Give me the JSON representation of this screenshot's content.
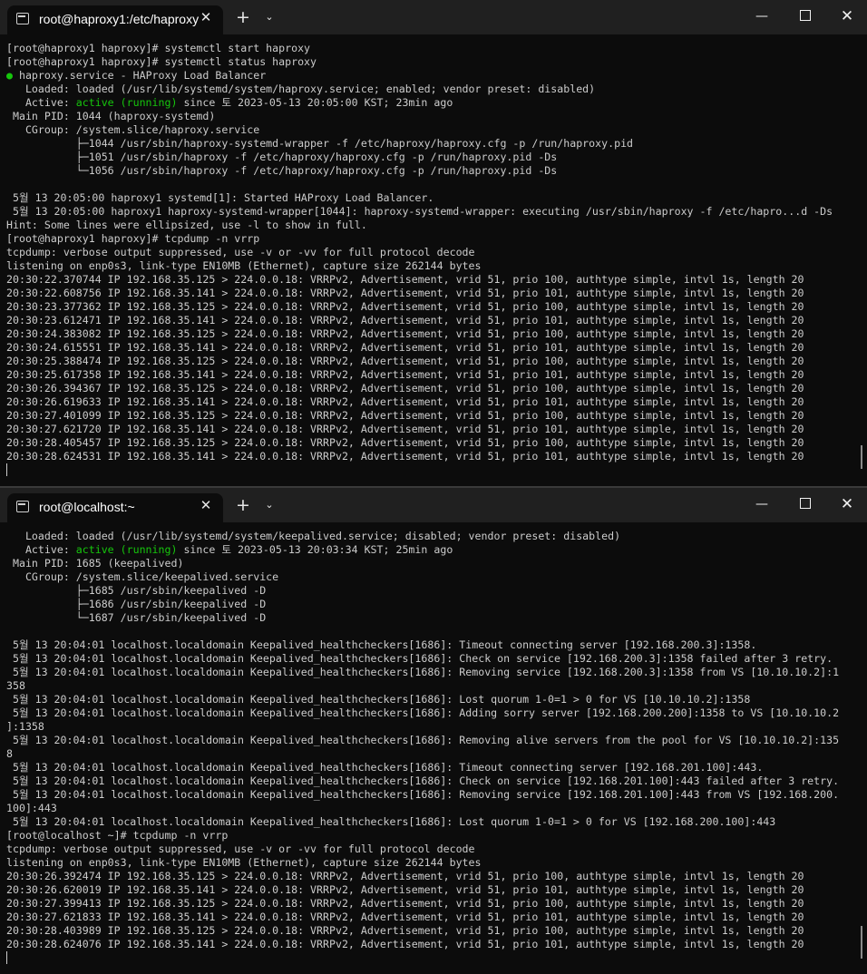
{
  "window1": {
    "tab_title": "root@haproxy1:/etc/haproxy",
    "lines": [
      "[root@haproxy1 haproxy]# systemctl start haproxy",
      "[root@haproxy1 haproxy]# systemctl status haproxy",
      "● haproxy.service - HAProxy Load Balancer",
      "   Loaded: loaded (/usr/lib/systemd/system/haproxy.service; enabled; vendor preset: disabled)",
      "   Active: active (running) since 토 2023-05-13 20:05:00 KST; 23min ago",
      " Main PID: 1044 (haproxy-systemd)",
      "   CGroup: /system.slice/haproxy.service",
      "           ├─1044 /usr/sbin/haproxy-systemd-wrapper -f /etc/haproxy/haproxy.cfg -p /run/haproxy.pid",
      "           ├─1051 /usr/sbin/haproxy -f /etc/haproxy/haproxy.cfg -p /run/haproxy.pid -Ds",
      "           └─1056 /usr/sbin/haproxy -f /etc/haproxy/haproxy.cfg -p /run/haproxy.pid -Ds",
      "",
      " 5월 13 20:05:00 haproxy1 systemd[1]: Started HAProxy Load Balancer.",
      " 5월 13 20:05:00 haproxy1 haproxy-systemd-wrapper[1044]: haproxy-systemd-wrapper: executing /usr/sbin/haproxy -f /etc/hapro...d -Ds",
      "Hint: Some lines were ellipsized, use -l to show in full.",
      "[root@haproxy1 haproxy]# tcpdump -n vrrp",
      "tcpdump: verbose output suppressed, use -v or -vv for full protocol decode",
      "listening on enp0s3, link-type EN10MB (Ethernet), capture size 262144 bytes",
      "20:30:22.370744 IP 192.168.35.125 > 224.0.0.18: VRRPv2, Advertisement, vrid 51, prio 100, authtype simple, intvl 1s, length 20",
      "20:30:22.608756 IP 192.168.35.141 > 224.0.0.18: VRRPv2, Advertisement, vrid 51, prio 101, authtype simple, intvl 1s, length 20",
      "20:30:23.377362 IP 192.168.35.125 > 224.0.0.18: VRRPv2, Advertisement, vrid 51, prio 100, authtype simple, intvl 1s, length 20",
      "20:30:23.612471 IP 192.168.35.141 > 224.0.0.18: VRRPv2, Advertisement, vrid 51, prio 101, authtype simple, intvl 1s, length 20",
      "20:30:24.383082 IP 192.168.35.125 > 224.0.0.18: VRRPv2, Advertisement, vrid 51, prio 100, authtype simple, intvl 1s, length 20",
      "20:30:24.615551 IP 192.168.35.141 > 224.0.0.18: VRRPv2, Advertisement, vrid 51, prio 101, authtype simple, intvl 1s, length 20",
      "20:30:25.388474 IP 192.168.35.125 > 224.0.0.18: VRRPv2, Advertisement, vrid 51, prio 100, authtype simple, intvl 1s, length 20",
      "20:30:25.617358 IP 192.168.35.141 > 224.0.0.18: VRRPv2, Advertisement, vrid 51, prio 101, authtype simple, intvl 1s, length 20",
      "20:30:26.394367 IP 192.168.35.125 > 224.0.0.18: VRRPv2, Advertisement, vrid 51, prio 100, authtype simple, intvl 1s, length 20",
      "20:30:26.619633 IP 192.168.35.141 > 224.0.0.18: VRRPv2, Advertisement, vrid 51, prio 101, authtype simple, intvl 1s, length 20",
      "20:30:27.401099 IP 192.168.35.125 > 224.0.0.18: VRRPv2, Advertisement, vrid 51, prio 100, authtype simple, intvl 1s, length 20",
      "20:30:27.621720 IP 192.168.35.141 > 224.0.0.18: VRRPv2, Advertisement, vrid 51, prio 101, authtype simple, intvl 1s, length 20",
      "20:30:28.405457 IP 192.168.35.125 > 224.0.0.18: VRRPv2, Advertisement, vrid 51, prio 100, authtype simple, intvl 1s, length 20",
      "20:30:28.624531 IP 192.168.35.141 > 224.0.0.18: VRRPv2, Advertisement, vrid 51, prio 101, authtype simple, intvl 1s, length 20"
    ]
  },
  "window2": {
    "tab_title": "root@localhost:~",
    "lines": [
      "   Loaded: loaded (/usr/lib/systemd/system/keepalived.service; disabled; vendor preset: disabled)",
      "   Active: active (running) since 토 2023-05-13 20:03:34 KST; 25min ago",
      " Main PID: 1685 (keepalived)",
      "   CGroup: /system.slice/keepalived.service",
      "           ├─1685 /usr/sbin/keepalived -D",
      "           ├─1686 /usr/sbin/keepalived -D",
      "           └─1687 /usr/sbin/keepalived -D",
      "",
      " 5월 13 20:04:01 localhost.localdomain Keepalived_healthcheckers[1686]: Timeout connecting server [192.168.200.3]:1358.",
      " 5월 13 20:04:01 localhost.localdomain Keepalived_healthcheckers[1686]: Check on service [192.168.200.3]:1358 failed after 3 retry.",
      " 5월 13 20:04:01 localhost.localdomain Keepalived_healthcheckers[1686]: Removing service [192.168.200.3]:1358 from VS [10.10.10.2]:1",
      "358",
      " 5월 13 20:04:01 localhost.localdomain Keepalived_healthcheckers[1686]: Lost quorum 1-0=1 > 0 for VS [10.10.10.2]:1358",
      " 5월 13 20:04:01 localhost.localdomain Keepalived_healthcheckers[1686]: Adding sorry server [192.168.200.200]:1358 to VS [10.10.10.2",
      "]:1358",
      " 5월 13 20:04:01 localhost.localdomain Keepalived_healthcheckers[1686]: Removing alive servers from the pool for VS [10.10.10.2]:135",
      "8",
      " 5월 13 20:04:01 localhost.localdomain Keepalived_healthcheckers[1686]: Timeout connecting server [192.168.201.100]:443.",
      " 5월 13 20:04:01 localhost.localdomain Keepalived_healthcheckers[1686]: Check on service [192.168.201.100]:443 failed after 3 retry.",
      " 5월 13 20:04:01 localhost.localdomain Keepalived_healthcheckers[1686]: Removing service [192.168.201.100]:443 from VS [192.168.200.",
      "100]:443",
      " 5월 13 20:04:01 localhost.localdomain Keepalived_healthcheckers[1686]: Lost quorum 1-0=1 > 0 for VS [192.168.200.100]:443",
      "[root@localhost ~]# tcpdump -n vrrp",
      "tcpdump: verbose output suppressed, use -v or -vv for full protocol decode",
      "listening on enp0s3, link-type EN10MB (Ethernet), capture size 262144 bytes",
      "20:30:26.392474 IP 192.168.35.125 > 224.0.0.18: VRRPv2, Advertisement, vrid 51, prio 100, authtype simple, intvl 1s, length 20",
      "20:30:26.620019 IP 192.168.35.141 > 224.0.0.18: VRRPv2, Advertisement, vrid 51, prio 101, authtype simple, intvl 1s, length 20",
      "20:30:27.399413 IP 192.168.35.125 > 224.0.0.18: VRRPv2, Advertisement, vrid 51, prio 100, authtype simple, intvl 1s, length 20",
      "20:30:27.621833 IP 192.168.35.141 > 224.0.0.18: VRRPv2, Advertisement, vrid 51, prio 101, authtype simple, intvl 1s, length 20",
      "20:30:28.403989 IP 192.168.35.125 > 224.0.0.18: VRRPv2, Advertisement, vrid 51, prio 100, authtype simple, intvl 1s, length 20",
      "20:30:28.624076 IP 192.168.35.141 > 224.0.0.18: VRRPv2, Advertisement, vrid 51, prio 101, authtype simple, intvl 1s, length 20"
    ]
  },
  "icons": {
    "terminal": "terminal-icon",
    "close_tab": "close-icon",
    "new_tab": "plus-icon",
    "dropdown": "chevron-down-icon",
    "minimize": "minimize-icon",
    "maximize": "maximize-icon",
    "close_window": "close-window-icon"
  },
  "colors": {
    "background": "#0c0c0c",
    "titlebar": "#202020",
    "text": "#cccccc",
    "active_green": "#16c60c"
  }
}
